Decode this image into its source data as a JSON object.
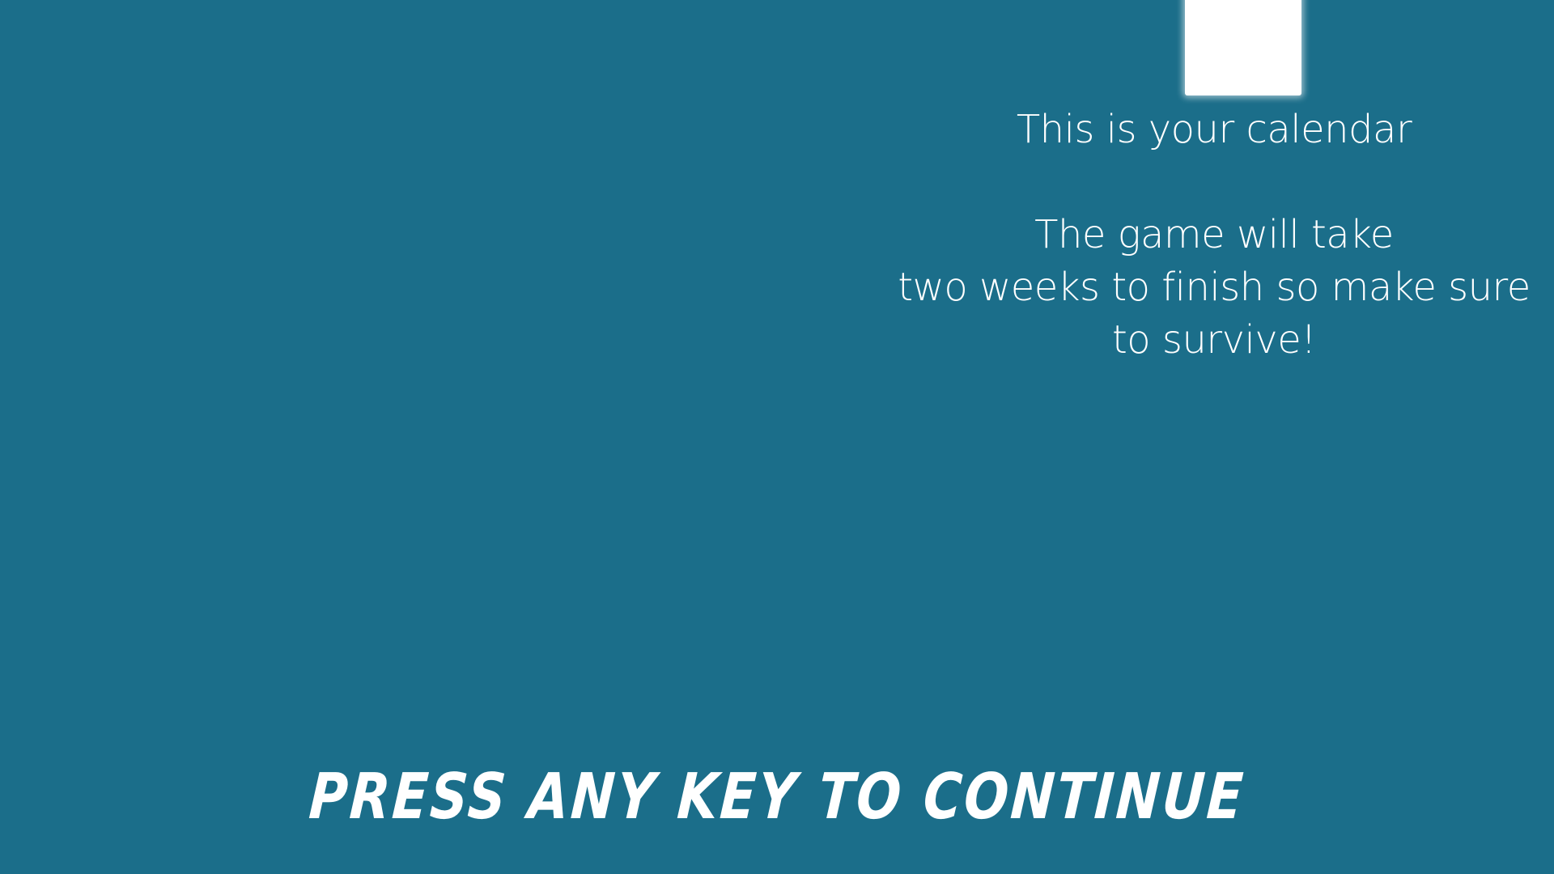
{
  "background_color": "#1b6e8a",
  "highlight_color": "#ffffff",
  "tutorial": {
    "line1": "This is your calendar",
    "line2": "The game will take",
    "line3": "two weeks to finish so make sure",
    "line4": "to survive!"
  },
  "prompt": {
    "label": "PRESS ANY KEY TO CONTINUE"
  }
}
